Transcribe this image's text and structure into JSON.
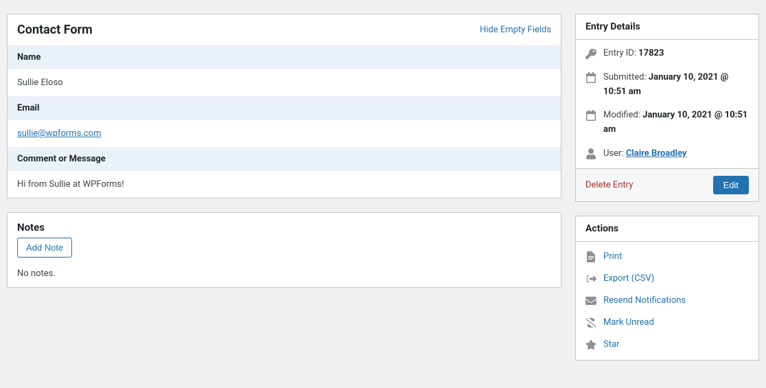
{
  "form": {
    "title": "Contact Form",
    "hide_empty_label": "Hide Empty Fields",
    "fields": {
      "name_label": "Name",
      "name_value": "Sullie Eloso",
      "email_label": "Email",
      "email_value": "sullie@wpforms.com",
      "comment_label": "Comment or Message",
      "comment_value": "Hi from Sullie at WPForms!"
    }
  },
  "notes": {
    "title": "Notes",
    "add_note_label": "Add Note",
    "empty_text": "No notes."
  },
  "details": {
    "title": "Entry Details",
    "entry_id_label": "Entry ID: ",
    "entry_id_value": "17823",
    "submitted_label": "Submitted: ",
    "submitted_value": "January 10, 2021 @ 10:51 am",
    "modified_label": "Modified: ",
    "modified_value": "January 10, 2021 @ 10:51 am",
    "user_label": "User: ",
    "user_value": "Claire Broadley",
    "delete_label": "Delete Entry",
    "edit_label": "Edit"
  },
  "actions": {
    "title": "Actions",
    "print": "Print",
    "export": "Export (CSV)",
    "resend": "Resend Notifications",
    "mark_unread": "Mark Unread",
    "star": "Star"
  }
}
